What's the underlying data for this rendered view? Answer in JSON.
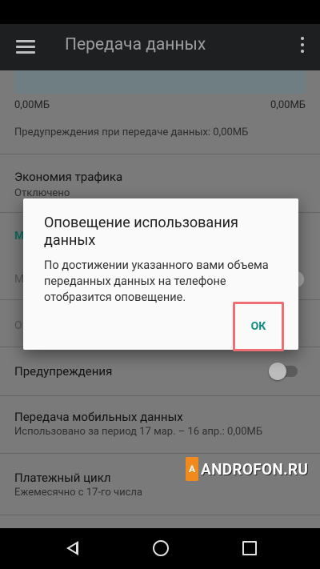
{
  "app": {
    "title": "Передача данных"
  },
  "usage": {
    "min_label": "0,00МБ",
    "max_label": "0,00МБ",
    "warning_text": "Предупреждения при передаче данных: 0,00МБ"
  },
  "settings": {
    "traffic_saver": {
      "title": "Экономия трафика",
      "subtitle": "Отключено"
    },
    "section_letter": "М",
    "faded_letter_1": "М",
    "faded_letter_2": "О",
    "warnings": {
      "title": "Предупреждения"
    },
    "mobile_data": {
      "title": "Передача мобильных данных",
      "subtitle": "Использовано за период 17 мар. – 16 апр.: 0,00МБ"
    },
    "billing_cycle": {
      "title": "Платежный цикл",
      "subtitle": "Ежемесячно с 17-го числа"
    }
  },
  "dialog": {
    "title": "Оповещение использования данных",
    "body": "По достижении указанного вами объема переданных данных на телефоне отобразится оповещение.",
    "ok_label": "ОК"
  },
  "watermark": {
    "text": "ANDROFON.RU",
    "icon_letter": "A"
  },
  "colors": {
    "accent": "#0f8b81",
    "highlight": "#ef6e74",
    "appbar": "#1d1f20",
    "watermark_icon": "#f08a1c"
  }
}
